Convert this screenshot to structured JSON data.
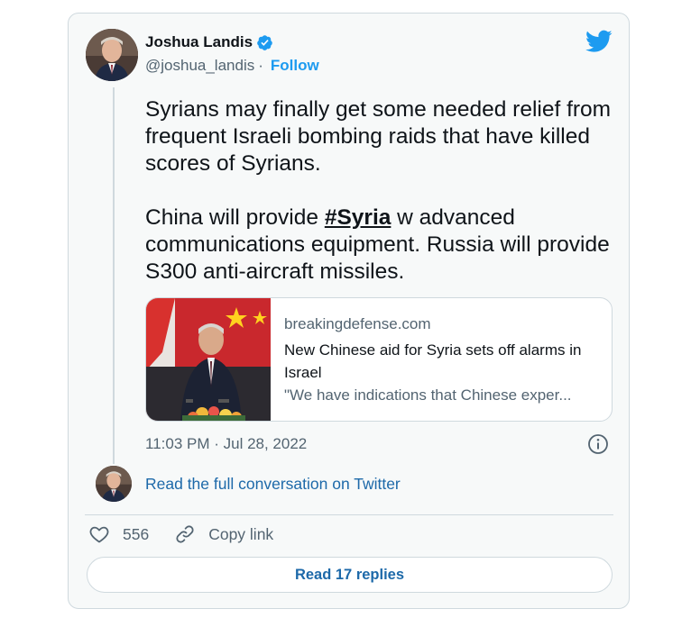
{
  "author": {
    "display_name": "Joshua Landis",
    "handle": "@joshua_landis",
    "separator": "·",
    "follow_label": "Follow"
  },
  "tweet": {
    "paragraph1": "Syrians may finally get some needed relief from frequent Israeli bombing raids that have killed scores of Syrians.",
    "paragraph2_before": "China  will provide ",
    "hashtag": "#Syria",
    "paragraph2_after": " w advanced communications equipment. Russia will provide S300 anti-aircraft missiles.",
    "timestamp": "11:03 PM · Jul 28, 2022"
  },
  "link_card": {
    "domain": "breakingdefense.com",
    "title": "New Chinese aid for Syria sets off alarms in Israel",
    "description": "\"We have indications that Chinese exper..."
  },
  "conversation": {
    "read_label": "Read the full conversation on Twitter"
  },
  "actions": {
    "like_count": "556",
    "copy_label": "Copy link"
  },
  "replies": {
    "label": "Read 17 replies"
  },
  "colors": {
    "accent": "#1d9bf0",
    "link": "#1d69a9",
    "muted": "#536471",
    "border": "#cfd9de",
    "card_bg": "#f7f9f9"
  },
  "icons": [
    "verified-badge-icon",
    "twitter-bird-icon",
    "info-icon",
    "heart-icon",
    "link-icon"
  ]
}
